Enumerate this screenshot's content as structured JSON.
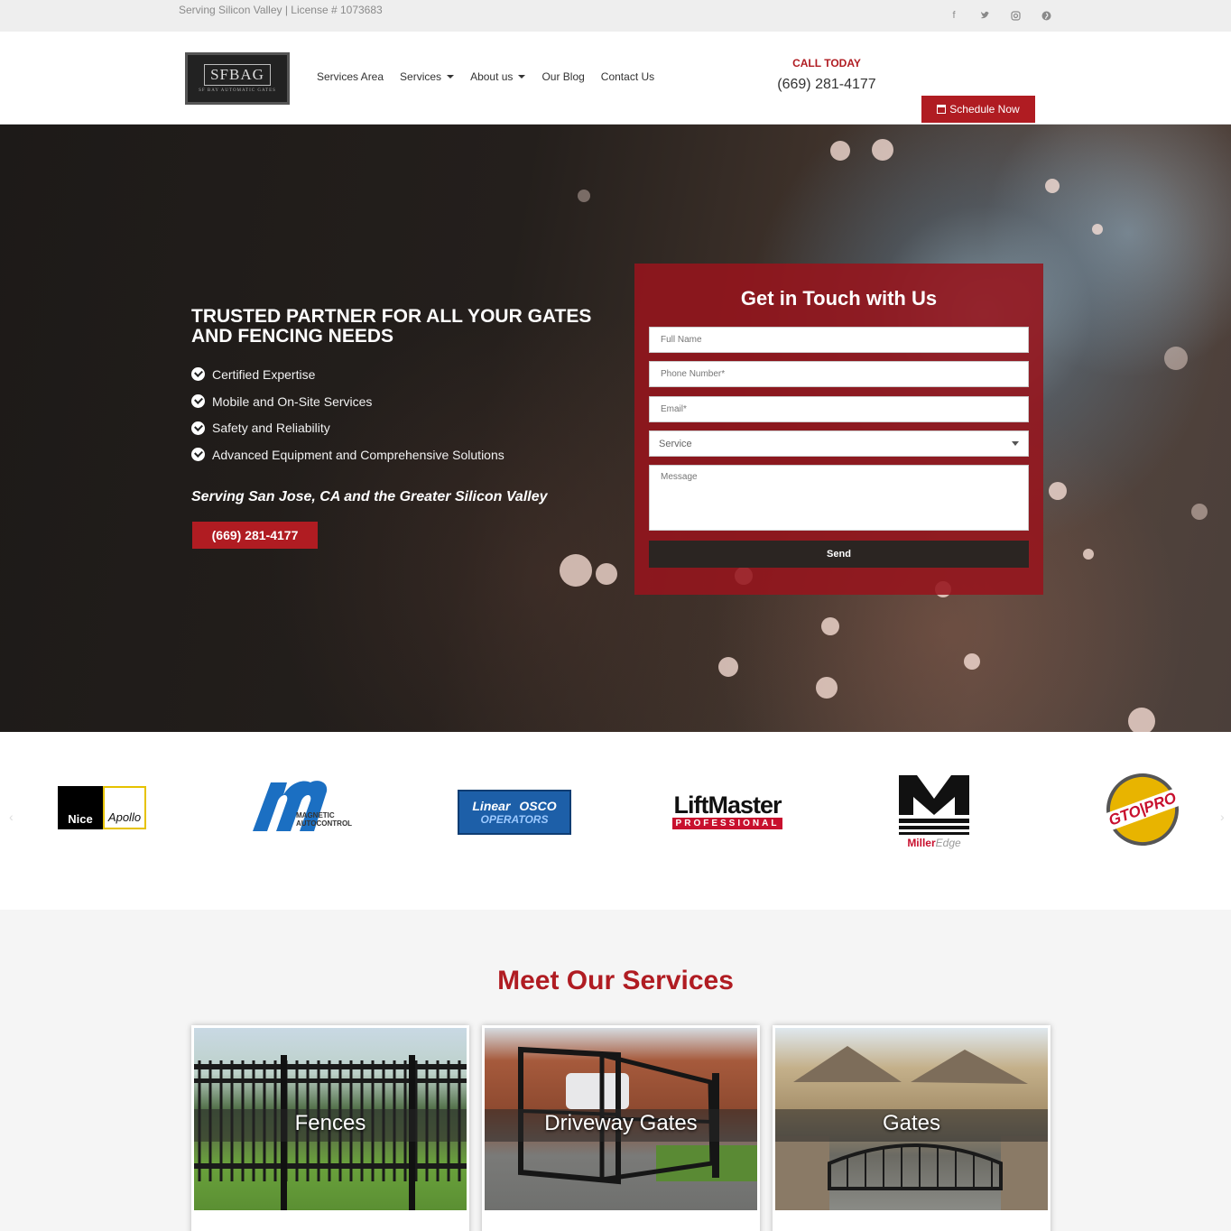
{
  "topbar": {
    "license": "Serving Silicon Valley | License # 1073683",
    "socials": [
      "facebook-icon",
      "twitter-icon",
      "instagram-icon",
      "pinterest-icon"
    ]
  },
  "header": {
    "logo_text": "SFBAG",
    "logo_sub": "SF BAY AUTOMATIC GATES",
    "nav": [
      {
        "label": "Services Area",
        "dropdown": false
      },
      {
        "label": "Services",
        "dropdown": true
      },
      {
        "label": "About us",
        "dropdown": true
      },
      {
        "label": "Our Blog",
        "dropdown": false
      },
      {
        "label": "Contact Us",
        "dropdown": false
      }
    ],
    "call_label": "CALL TODAY",
    "call_phone": "(669) 281-4177",
    "schedule_label": "Schedule Now"
  },
  "hero": {
    "title": "TRUSTED PARTNER FOR ALL YOUR GATES AND FENCING NEEDS",
    "features": [
      "Certified Expertise",
      "Mobile and On-Site Services",
      "Safety and Reliability",
      "Advanced Equipment and Comprehensive Solutions"
    ],
    "serving": "Serving San Jose, CA and the Greater Silicon Valley",
    "phone_button": "(669) 281-4177"
  },
  "form": {
    "title": "Get in Touch with Us",
    "full_name_placeholder": "Full Name",
    "phone_placeholder": "Phone Number*",
    "email_placeholder": "Email*",
    "service_selected": "Service",
    "message_placeholder": "Message",
    "send_label": "Send"
  },
  "partners": {
    "logos": [
      {
        "name": "nice-apollo-logo",
        "parts": [
          "Nice",
          "Apollo"
        ]
      },
      {
        "name": "magnetic-autocontrol-logo",
        "parts": [
          "MAGNETIC",
          "AUTOCONTROL"
        ]
      },
      {
        "name": "linear-osco-logo",
        "parts": [
          "Linear",
          "OSCO",
          "OPERATORS"
        ]
      },
      {
        "name": "liftmaster-logo",
        "parts": [
          "LiftMaster",
          "PROFESSIONAL"
        ]
      },
      {
        "name": "milleredge-logo",
        "parts": [
          "Miller",
          "Edge"
        ]
      },
      {
        "name": "gto-pro-logo",
        "parts": [
          "GTO|PRO"
        ]
      }
    ]
  },
  "services": {
    "title": "Meet Our Services",
    "cards": [
      {
        "title": "Fences"
      },
      {
        "title": "Driveway Gates"
      },
      {
        "title": "Gates"
      }
    ]
  },
  "colors": {
    "accent": "#b01c22",
    "dark": "#2b2522"
  }
}
